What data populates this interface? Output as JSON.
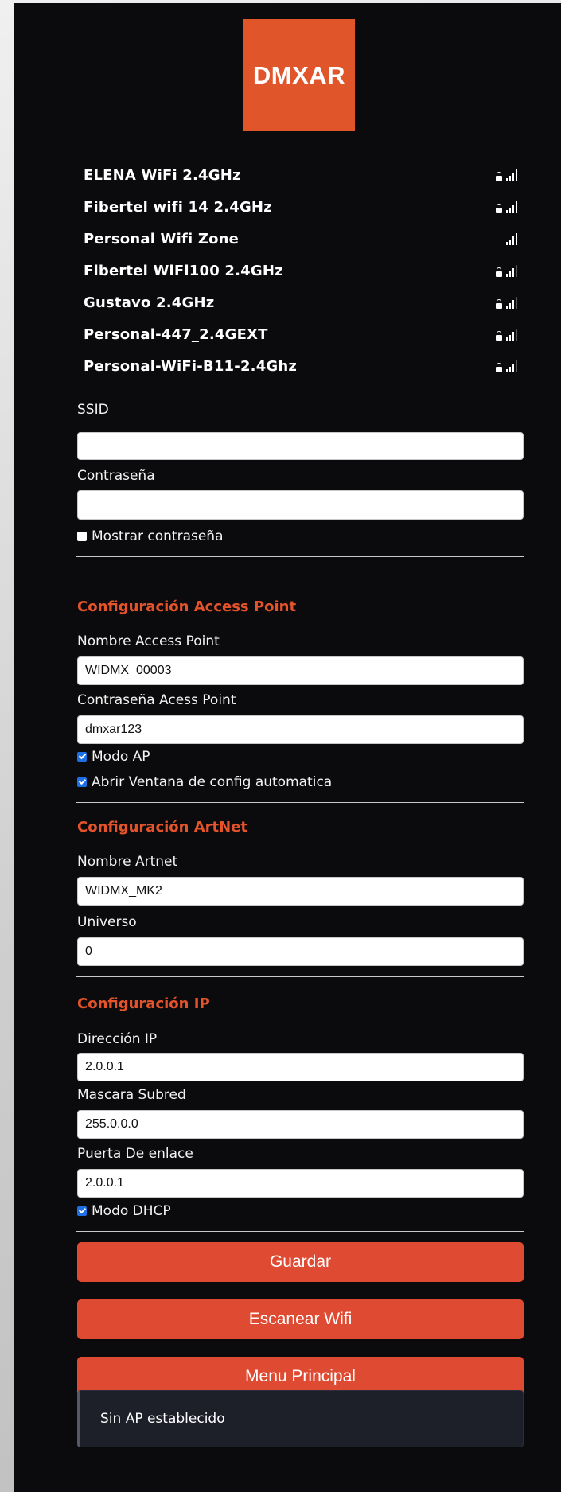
{
  "logo": {
    "text": "DMXAR"
  },
  "networks": [
    {
      "name": "ELENA WiFi 2.4GHz",
      "locked": true,
      "bars": 4
    },
    {
      "name": "Fibertel wifi 14 2.4GHz",
      "locked": true,
      "bars": 4
    },
    {
      "name": "Personal Wifi Zone",
      "locked": false,
      "bars": 4
    },
    {
      "name": "Fibertel WiFi100 2.4GHz",
      "locked": true,
      "bars": 3
    },
    {
      "name": "Gustavo 2.4GHz",
      "locked": true,
      "bars": 3
    },
    {
      "name": "Personal-447_2.4GEXT",
      "locked": true,
      "bars": 3
    },
    {
      "name": "Personal-WiFi-B11-2.4Ghz",
      "locked": true,
      "bars": 3
    }
  ],
  "wifi": {
    "ssid_label": "SSID",
    "ssid_value": "",
    "password_label": "Contraseña",
    "password_value": "",
    "show_password_label": "Mostrar contraseña",
    "show_password_checked": false
  },
  "ap": {
    "title": "Configuración Access Point",
    "name_label": "Nombre Access Point",
    "name_value": "WIDMX_00003",
    "password_label": "Contraseña Acess Point",
    "password_value": "dmxar123",
    "mode_label": "Modo AP",
    "mode_checked": true,
    "autoconfig_label": "Abrir Ventana de config automatica",
    "autoconfig_checked": true
  },
  "artnet": {
    "title": "Configuración ArtNet",
    "name_label": "Nombre Artnet",
    "name_value": "WIDMX_MK2",
    "universe_label": "Universo",
    "universe_value": "0"
  },
  "ip": {
    "title": "Configuración IP",
    "address_label": "Dirección IP",
    "address_value": "2.0.0.1",
    "mask_label": "Mascara Subred",
    "mask_value": "255.0.0.0",
    "gateway_label": "Puerta De enlace",
    "gateway_value": "2.0.0.1",
    "dhcp_label": "Modo DHCP",
    "dhcp_checked": true
  },
  "buttons": {
    "save": "Guardar",
    "scan": "Escanear Wifi",
    "menu": "Menu Principal"
  },
  "status": {
    "message": "Sin AP establecido"
  },
  "colors": {
    "accent": "#e1552b",
    "button": "#df4b32",
    "background": "#0b0b0d",
    "status_bg": "#1e2029"
  }
}
